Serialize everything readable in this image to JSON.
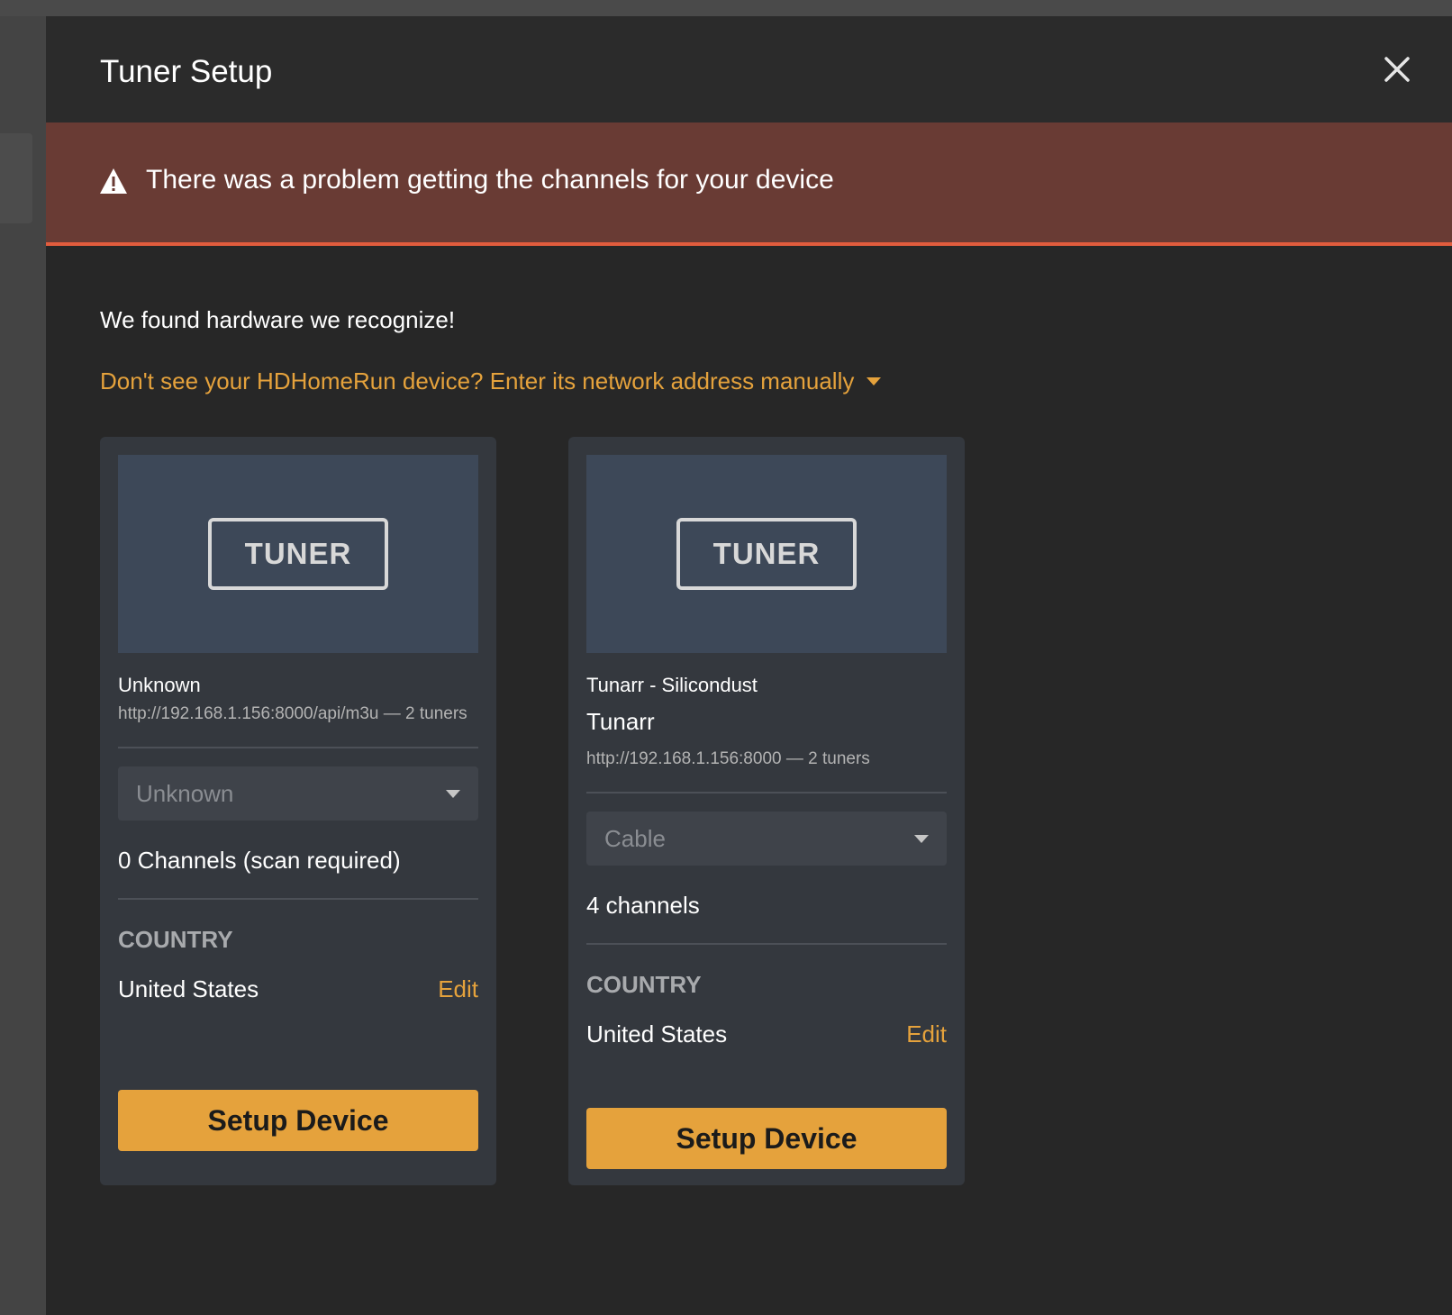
{
  "modal": {
    "title": "Tuner Setup"
  },
  "alert": {
    "message": "There was a problem getting the channels for your device"
  },
  "intro": {
    "found_text": "We found hardware we recognize!",
    "manual_link": "Don't see your HDHomeRun device? Enter its network address manually"
  },
  "devices": [
    {
      "badge": "TUNER",
      "name": "Unknown",
      "model": "",
      "meta": "http://192.168.1.156:8000/api/m3u — 2 tuners",
      "select_value": "Unknown",
      "channels": "0 Channels (scan required)",
      "country_label": "COUNTRY",
      "country_value": "United States",
      "edit_label": "Edit",
      "button_label": "Setup Device"
    },
    {
      "badge": "TUNER",
      "name": "Tunarr - Silicondust",
      "model": "Tunarr",
      "meta": "http://192.168.1.156:8000 — 2 tuners",
      "select_value": "Cable",
      "channels": "4 channels",
      "country_label": "COUNTRY",
      "country_value": "United States",
      "edit_label": "Edit",
      "button_label": "Setup Device"
    }
  ],
  "colors": {
    "accent": "#e5a23c",
    "alert_bg": "#693b34",
    "alert_border": "#e15c3d"
  },
  "icons": {
    "close": "close-icon",
    "warning": "warning-icon",
    "dropdown": "chevron-down-icon"
  }
}
